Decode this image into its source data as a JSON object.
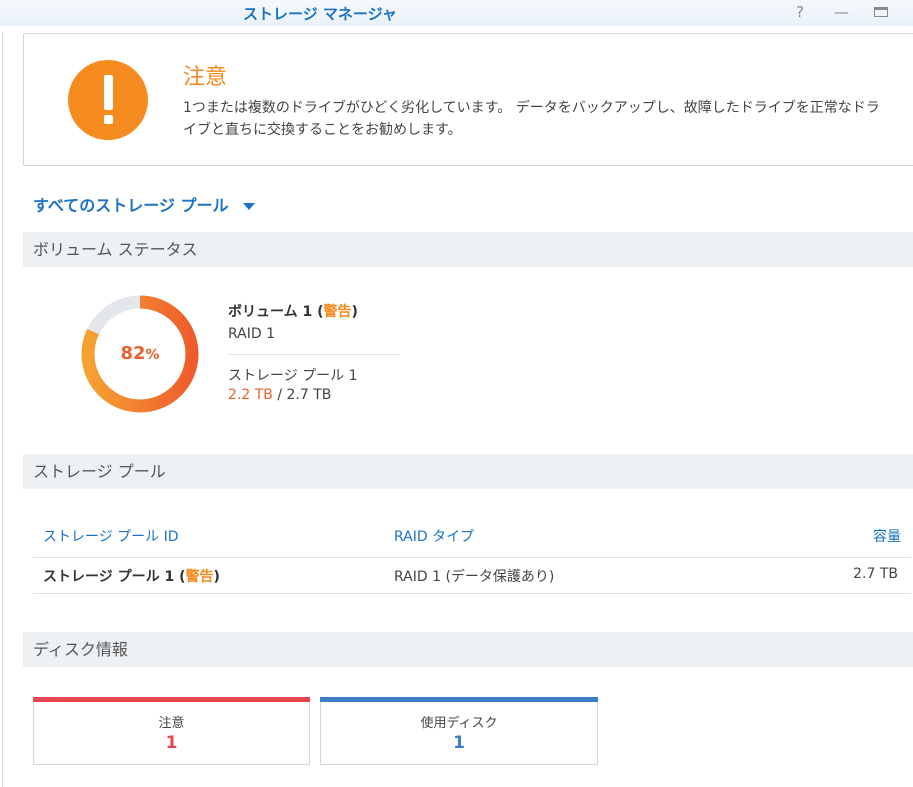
{
  "window": {
    "title": "ストレージ マネージャ",
    "help_label": "?",
    "minimize_label": "—"
  },
  "alert": {
    "title": "注意",
    "message": "1つまたは複数のドライブがひどく劣化しています。 データをバックアップし、故障したドライブを正常なドライブと直ちに交換することをお勧めします。",
    "icon": "exclamation-icon",
    "color": "#f58a1f"
  },
  "pool_selector": {
    "label": "すべてのストレージ プール"
  },
  "volume_status": {
    "header": "ボリューム ステータス",
    "usage_percent": 82,
    "percent_value": "82",
    "percent_sign": "%",
    "volume_name": "ボリューム 1",
    "paren_open": " (",
    "status": "警告",
    "paren_close": ")",
    "raid": "RAID 1",
    "pool": "ストレージ プール 1",
    "used": "2.2 TB",
    "total_sep": " / ",
    "total": "2.7 TB",
    "ring_colors": [
      "#f5a233",
      "#ef5c2c"
    ],
    "track_color": "#e3e6ea"
  },
  "storage_pool": {
    "header": "ストレージ プール",
    "columns": [
      "ストレージ プール ID",
      "RAID タイプ",
      "容量"
    ],
    "rows": [
      {
        "name": "ストレージ プール 1",
        "paren_open": " (",
        "status": "警告",
        "paren_close": ")",
        "raid_type": "RAID 1 (データ保護あり)",
        "capacity": "2.7 TB"
      }
    ]
  },
  "disk_info": {
    "header": "ディスク情報",
    "cards": [
      {
        "label": "注意",
        "value": "1",
        "color": "#e8464f"
      },
      {
        "label": "使用ディスク",
        "value": "1",
        "color": "#3c7fc6"
      }
    ]
  }
}
